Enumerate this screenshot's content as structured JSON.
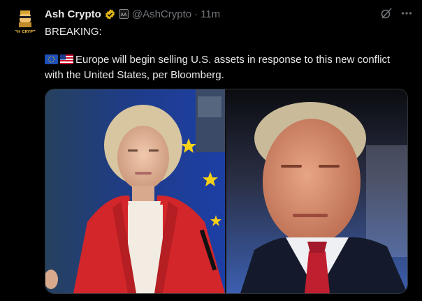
{
  "post": {
    "display_name": "Ash Crypto",
    "handle": "@AshCrypto",
    "separator": "·",
    "time": "11m",
    "avatar_text": "ASH CRYPTO",
    "text_line1": "BREAKING:",
    "text_line2": "Europe will begin selling U.S. assets in response to this new conflict with the United States, per Bloomberg."
  },
  "icons": {
    "verified": "verified-badge-icon",
    "affiliate": "affiliate-badge-icon",
    "grok": "grok-icon",
    "more": "more-options-icon",
    "flag_eu": "eu-flag-icon",
    "flag_us": "us-flag-icon"
  },
  "colors": {
    "background": "#000000",
    "text": "#e7e9ea",
    "secondary": "#71767b",
    "verified_gold": "#e2b719"
  }
}
